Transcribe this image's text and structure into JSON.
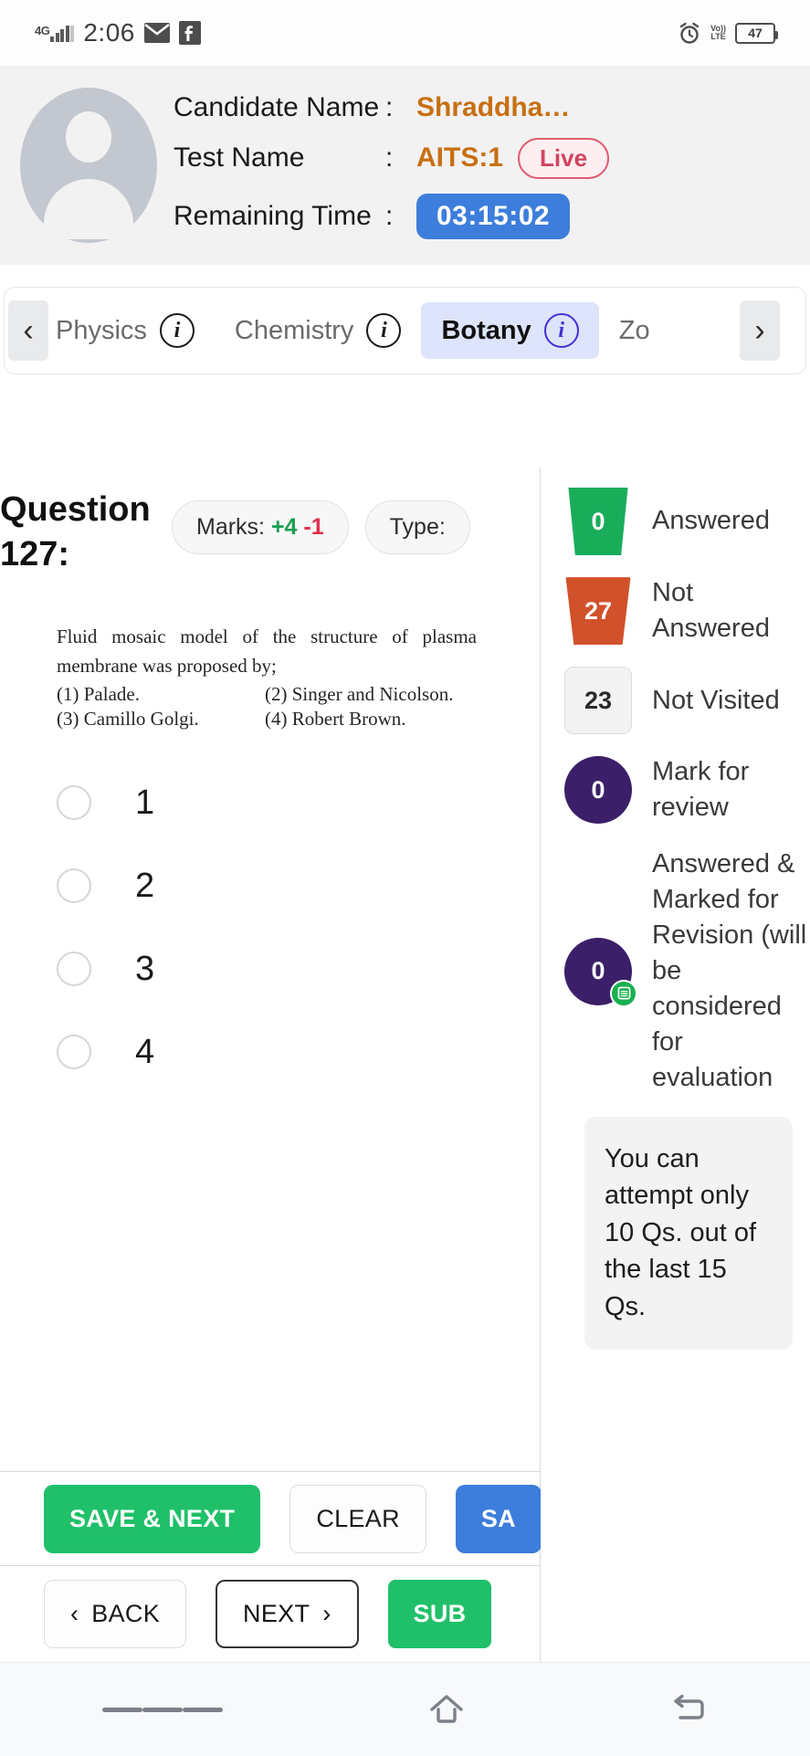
{
  "status_bar": {
    "network": "4G",
    "time": "2:06",
    "icons": [
      "mail-icon",
      "facebook-icon",
      "alarm-icon"
    ],
    "volte_line1": "Vo))",
    "volte_line2": "LTE",
    "battery": "47"
  },
  "header": {
    "avatar": "user-avatar-placeholder",
    "rows": [
      {
        "label": "Candidate Name",
        "colon": ":",
        "value": "Shraddha…"
      },
      {
        "label": "Test Name",
        "colon": ":",
        "value": "AITS:1",
        "badge": "Live"
      },
      {
        "label": "Remaining Time",
        "colon": ":",
        "value": "03:15:02"
      }
    ]
  },
  "tabs": {
    "prev_arrow": "‹",
    "next_arrow": "›",
    "items": [
      {
        "label": "Physics",
        "info": "i",
        "active": false
      },
      {
        "label": "Chemistry",
        "info": "i",
        "active": false
      },
      {
        "label": "Botany",
        "info": "i",
        "active": true
      },
      {
        "label": "Zo",
        "info": "",
        "active": false
      }
    ]
  },
  "question": {
    "title_line1": "Question",
    "title_line2": "127:",
    "marks_label": "Marks:",
    "marks_positive": "+4",
    "marks_negative": "-1",
    "type_label": "Type:",
    "stem": "Fluid mosaic model of the structure of plasma membrane was proposed by;",
    "choices_text": [
      "(1)  Palade.",
      "(2)  Singer and Nicolson.",
      "(3)  Camillo Golgi.",
      "(4)  Robert Brown."
    ],
    "options": [
      {
        "label": "1",
        "selected": false
      },
      {
        "label": "2",
        "selected": false
      },
      {
        "label": "3",
        "selected": false
      },
      {
        "label": "4",
        "selected": false
      }
    ]
  },
  "actions": {
    "save_and_next": "SAVE & NEXT",
    "clear": "CLEAR",
    "save_partial": "SA",
    "back": "BACK",
    "back_arrow": "‹",
    "next": "NEXT",
    "next_arrow": "›",
    "submit_partial": "SUB"
  },
  "legend": {
    "items": [
      {
        "count": "0",
        "label": "Answered",
        "style": "answered"
      },
      {
        "count": "27",
        "label": "Not Answered",
        "style": "not-answered"
      },
      {
        "count": "23",
        "label": "Not Visited",
        "style": "not-visited"
      },
      {
        "count": "0",
        "label": "Mark for review",
        "style": "mark-for-review"
      },
      {
        "count": "0",
        "label": "Answered & Marked for Revision (will be considered for evaluation",
        "style": "answered-marked"
      }
    ],
    "note": "You can attempt only 10 Qs. out of the last 15 Qs."
  },
  "android_nav": {
    "recents": "recents-icon",
    "home": "home-icon",
    "back": "back-icon"
  },
  "colors": {
    "accent_blue": "#3d7ddb",
    "green": "#1fc069",
    "orange_value": "#c77011",
    "live_red": "#d1445e",
    "purple": "#3b1f68",
    "answered_green": "#19ad5a",
    "not_answered_orange": "#d1512a",
    "tab_active_bg": "#dde4fb"
  }
}
